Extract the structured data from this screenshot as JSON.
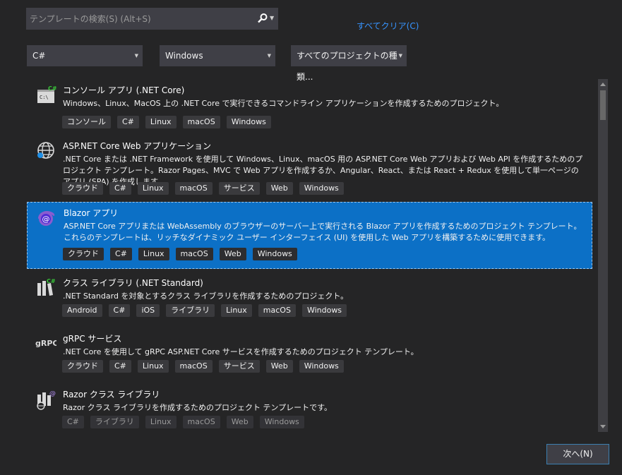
{
  "search": {
    "placeholder": "テンプレートの検索(S) (Alt+S)",
    "value": ""
  },
  "clear_all": "すべてクリア(C)",
  "filters": {
    "language": "C#",
    "platform": "Windows",
    "project_type": "すべてのプロジェクトの種類..."
  },
  "templates": [
    {
      "title": "コンソール アプリ (.NET Core)",
      "description": "Windows、Linux、MacOS 上の .NET Core で実行できるコマンドライン アプリケーションを作成するためのプロジェクト。",
      "tags": [
        "コンソール",
        "C#",
        "Linux",
        "macOS",
        "Windows"
      ],
      "icon": "console-app-icon"
    },
    {
      "title": "ASP.NET Core Web アプリケーション",
      "description": ".NET Core または .NET Framework を使用して Windows、Linux、macOS 用の ASP.NET Core Web アプリおよび Web API を作成するためのプロジェクト テンプレート。Razor Pages、MVC で Web アプリを作成するか、Angular、React、または React + Redux を使用して単一ページのアプリ (SPA) を作成します。",
      "tags": [
        "クラウド",
        "C#",
        "Linux",
        "macOS",
        "サービス",
        "Web",
        "Windows"
      ],
      "icon": "globe-icon"
    },
    {
      "title": "Blazor アプリ",
      "description": "ASP.NET Core アプリまたは WebAssembly のブラウザーのサーバー上で実行される Blazor アプリを作成するためのプロジェクト テンプレート。これらのテンプレートは、リッチなダイナミック ユーザー インターフェイス (UI) を使用した Web アプリを構築するために使用できます。",
      "tags": [
        "クラウド",
        "C#",
        "Linux",
        "macOS",
        "Web",
        "Windows"
      ],
      "icon": "blazor-icon"
    },
    {
      "title": "クラス ライブラリ (.NET Standard)",
      "description": ".NET Standard を対象とするクラス ライブラリを作成するためのプロジェクト。",
      "tags": [
        "Android",
        "C#",
        "iOS",
        "ライブラリ",
        "Linux",
        "macOS",
        "Windows"
      ],
      "icon": "class-library-icon"
    },
    {
      "title": "gRPC サービス",
      "description": ".NET Core を使用して gRPC ASP.NET Core サービスを作成するためのプロジェクト テンプレート。",
      "tags": [
        "クラウド",
        "C#",
        "Linux",
        "macOS",
        "サービス",
        "Web",
        "Windows"
      ],
      "icon": "grpc-icon",
      "icon_text": "gRPC"
    },
    {
      "title": "Razor クラス ライブラリ",
      "description": "Razor クラス ライブラリを作成するためのプロジェクト テンプレートです。",
      "tags": [
        "C#",
        "ライブラリ",
        "Linux",
        "macOS",
        "Web",
        "Windows"
      ],
      "icon": "razor-library-icon"
    }
  ],
  "next_button": "次へ(N)",
  "colors": {
    "background": "#252526",
    "selected": "#0c70c6",
    "link": "#3794ff",
    "blazor": "#8a5cd0"
  }
}
